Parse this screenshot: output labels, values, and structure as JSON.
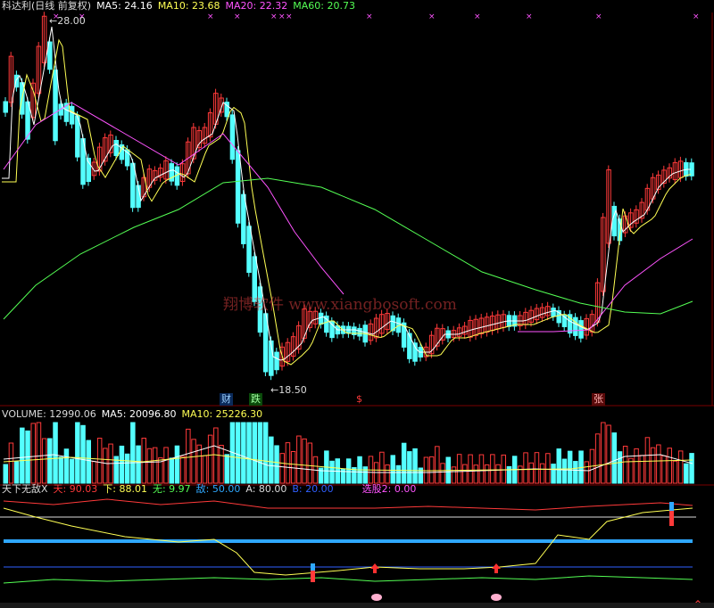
{
  "colors": {
    "up": "#ff3a3a",
    "down": "#54ffff",
    "ma5": "#ffffff",
    "ma10": "#ffff54",
    "ma20": "#ff54ff",
    "ma60": "#54ff54",
    "grid": "#7a0000",
    "blue": "#2fa8ff"
  },
  "kline_header": {
    "title": "科达利(日线 前复权)",
    "ma5": "MA5: 24.16",
    "ma10": "MA10: 23.68",
    "ma20": "MA20: 22.32",
    "ma60": "MA60: 20.73"
  },
  "price_labels": {
    "high": "28.00",
    "low": "18.50"
  },
  "watermark": "翔博软件 www.xiangbosoft.com",
  "event_tags": {
    "cai": "财",
    "die": "跌",
    "zhang": "张",
    "dollar": "$"
  },
  "volume_header": {
    "label": "VOLUME: 12990.06",
    "ma5": "MA5: 20096.80",
    "ma10": "MA10: 25226.30"
  },
  "indicator_header": {
    "name": "天下无敌X",
    "tian": "天: 90.03",
    "xia": "下: 88.01",
    "wu": "无: 9.97",
    "di": "敌: 50.00",
    "a": "A: 80.00",
    "b": "B: 20.00",
    "xuangu": "选股2: 0.00"
  },
  "icons": {
    "markers": "x-mark-icon",
    "arrow": "up-arrow-icon",
    "flower": "flower-icon",
    "diamond": "diamond-icon"
  }
}
